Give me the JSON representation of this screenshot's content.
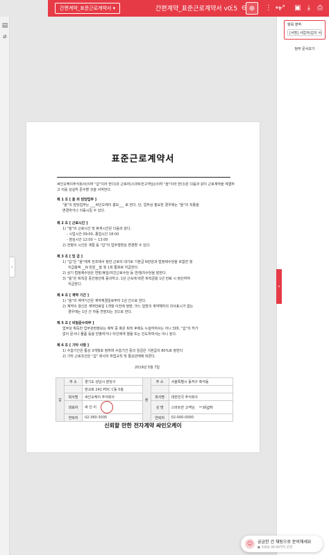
{
  "topbar": {
    "template_select": "간편계약_표준근로계약서 ▾",
    "title": "간편계약_표준근로계약서 v0.5"
  },
  "icons": {
    "more": "⋮",
    "zoom_out": "⊖",
    "zoom_in": "⊕",
    "fit_width": "↔",
    "fullscreen": "⤢",
    "save": "▣",
    "download": "⤓",
    "print": "⎙",
    "left_doc": "▤",
    "left_attach": "⌀",
    "left_handle": "›",
    "panel_handle": "›"
  },
  "panel": {
    "field_label": "항목 영역",
    "field_value": "[서명] 사업자(갑의 서명",
    "view_all": "첨부 문서보기"
  },
  "document": {
    "title": "표준근로계약서",
    "intro": "싸인오케이주식회사(이하 \"갑\"이라 한다)과 근로자(스마트한고객님)(이하 \"을\"이라 한다)은 다음과 같이 근로계약을 체결하고 이를 성실히 준수할 것을 서약한다.",
    "sections": [
      {
        "title": "제 1 조 [ 을 의 담당업무 ]",
        "lines": [
          "\"을\"의 담당업무는 ___싸인오케이 홍보___ 로 한다. 단, 업무상 필요한 경우에는 \"을\"의 직종을",
          "변경하거나 이동시킬 수 있다."
        ]
      },
      {
        "title": "제 2 조 [ 근로시간 ]",
        "lines": [
          "1) \"을\"의 근로시간 및 휴게시간은 다음과 같다.",
          "- 시업시간 09:00, 종업시간 18:00",
          "- 점심시간 12:00 ~ 13:00",
          "2) 전항의 시간은 계절 등 \"갑\"의 업무형편상 변경할 수 있다."
        ]
      },
      {
        "title": "제 3 조 [ 임  금 ]",
        "lines": [
          "1) \"갑\"은 \"을\"에게 전조에서 정한 근로의 대가로 기본급 N만원과 법정제수당을 포함한 월",
          "지급총액 __N 만원__을 월 1회 통화로 지급한다.",
          "2) 상기 법정제수당은 연장/휴일/야간근로수당 등 연/월차수당을 말한다.",
          "3) \"을\"은 퇴직금 중간정산에 동의하고, 1년 근속에 따른 퇴직금을 1년 만료 시 정산하여",
          "지급한다."
        ]
      },
      {
        "title": "제 4 조 [ 계약 기간 ]",
        "lines": [
          "1) \"을\"의 계약기간은 계약체결일로부터 1년 간으로 한다.",
          "2) 계약의 갱신은 계약만료일 1개월 이전에 쌍방, 어느 일방의 계약해지의 의사표시가 없는",
          "경우에는 1년 간 자동 연장되는 것으로 한다."
        ]
      },
      {
        "title": "제 5 조 [ 비밀준수의무 ]",
        "lines": [
          "업무상 획득한 업무관련정보는 제작 중 혹은 퇴직 후에도 누설하여서는 아니 되며, \"갑\"의 허가",
          "없이 문서나 물품 등을 반출하거나 타인에게 열람 또는 인도하여서는 아니 된다."
        ]
      },
      {
        "title": "제 6 조 [ 기타 사항 ]",
        "lines": [
          "1) 수습기간은 통상 3개월로 정하며 수습기간 중의 임금은 기본급의 80%로 정한다",
          "2) 기타 근로조건은 \"갑\" 회사의 취업규칙 및 통상관례에 따른다."
        ]
      }
    ],
    "date": "2019년   5월   7일",
    "party_a": {
      "side": "갑",
      "rows": [
        {
          "label": "주  소",
          "value": "경기도 성남시 분당구"
        },
        {
          "label": "",
          "value": "판교로 242 PDC C동 5층"
        },
        {
          "label": "회사명",
          "value": "싸인오케이 주식회사"
        },
        {
          "label": "대표자",
          "value": "싸 인 이"
        },
        {
          "label": "연락처",
          "value": "02-360-3035"
        }
      ]
    },
    "party_b": {
      "side": "을",
      "rows": [
        {
          "label": "주  소",
          "value": "서울특별시 동작구 흑석동"
        },
        {
          "label": "",
          "value": ""
        },
        {
          "label": "회사명",
          "value": "대한민국 주식회사"
        },
        {
          "label": "성  명",
          "value": "스마트한 고객님"
        },
        {
          "label": "연락처",
          "value": "02-000-0000"
        }
      ]
    },
    "footer": "신뢰할 만한 전자계약 싸인오케이"
  },
  "chat": {
    "main": "궁금한 건 채팅으로 문의해세요",
    "sub": "● 오류들 06:00부터 운영"
  },
  "colors": {
    "accent": "#e63a46",
    "stamp": "#d13a3a"
  }
}
